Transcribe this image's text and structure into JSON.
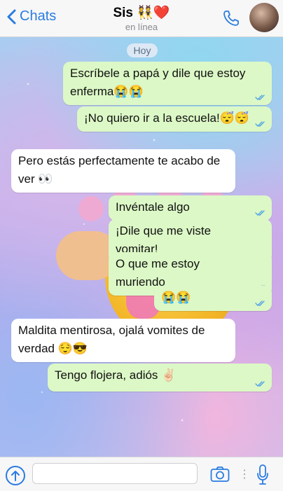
{
  "header": {
    "back_label": "Chats",
    "title": "Sis 👯❤️",
    "subtitle": "en línea"
  },
  "day_label": "Hoy",
  "messages": [
    {
      "dir": "out",
      "text": "Escríbele a papá y dile que estoy enferma😭😭"
    },
    {
      "dir": "out",
      "text": "¡No quiero ir a la escuela!😴😴"
    },
    {
      "dir": "in",
      "text": "Pero estás perfectamente te acabo de ver 👀"
    },
    {
      "dir": "out",
      "text": "Invéntale algo"
    },
    {
      "dir": "out",
      "text": "¡Dile que me viste vomitar!"
    },
    {
      "dir": "out",
      "text": "O que me estoy muriendo"
    },
    {
      "dir": "out",
      "text": "😭😭"
    },
    {
      "dir": "in",
      "text": "Maldita mentirosa, ojalá vomites de verdad  😌😎"
    },
    {
      "dir": "out",
      "text": "Tengo flojera, adiós ✌🏻"
    }
  ],
  "colors": {
    "accent": "#2a7ce0",
    "outgoing_bubble": "#dcf8c6",
    "incoming_bubble": "#ffffff",
    "read_ticks": "#4fa3e6"
  },
  "icons": {
    "back": "chevron-left-icon",
    "call": "phone-icon",
    "attach": "upload-arrow-icon",
    "camera": "camera-icon",
    "mic": "microphone-icon",
    "ticks": "double-check-icon"
  }
}
